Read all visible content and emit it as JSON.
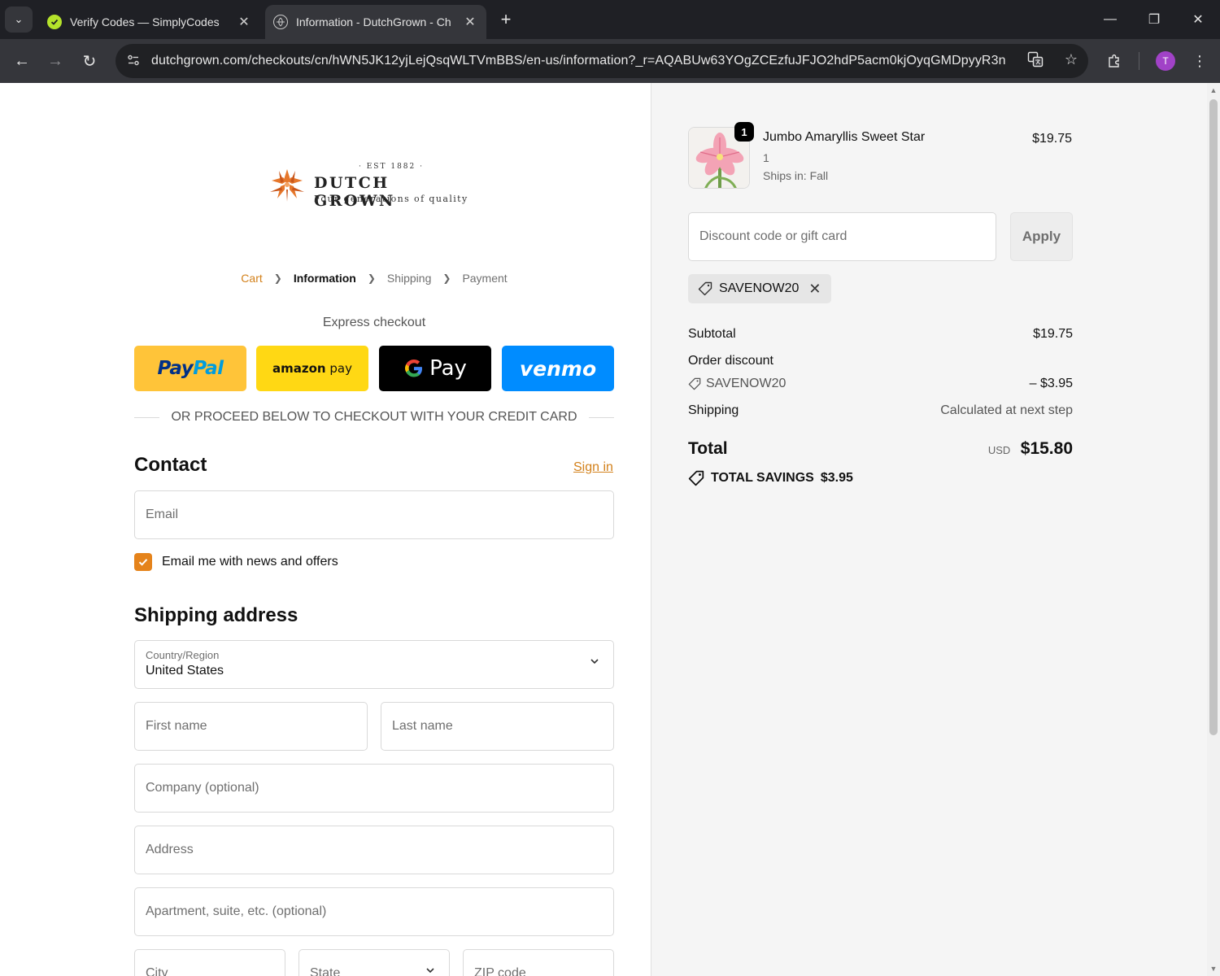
{
  "browser": {
    "tabs": [
      {
        "title": "Verify Codes — SimplyCodes",
        "active": false
      },
      {
        "title": "Information - DutchGrown - Ch",
        "active": true
      }
    ],
    "url": "dutchgrown.com/checkouts/cn/hWN5JK12yjLejQsqWLTVmBBS/en-us/information?_r=AQABUw63YOgZCEzfuJFJO2hdP5acm0kjOyqGMDpyyR3n",
    "profile_initial": "T",
    "accent_colors": {
      "profile": "#a142c7",
      "simplycodes": "#b5e32b"
    }
  },
  "store": {
    "logo_est": "· EST 1882 ·",
    "logo_name": "DUTCH GROWN",
    "logo_tagline": "Four generations of quality",
    "accent_color": "#d3811b"
  },
  "breadcrumb": {
    "items": [
      {
        "label": "Cart",
        "state": "link"
      },
      {
        "label": "Information",
        "state": "current"
      },
      {
        "label": "Shipping",
        "state": "upcoming"
      },
      {
        "label": "Payment",
        "state": "upcoming"
      }
    ]
  },
  "express": {
    "label": "Express checkout",
    "buttons": [
      {
        "name": "PayPal",
        "color": "#ffc439"
      },
      {
        "name": "amazon pay",
        "color": "#ffd814"
      },
      {
        "name": "G Pay",
        "color": "#000000"
      },
      {
        "name": "venmo",
        "color": "#008cff"
      }
    ],
    "divider_text": "OR PROCEED BELOW TO CHECKOUT WITH YOUR CREDIT CARD"
  },
  "contact": {
    "heading": "Contact",
    "sign_in": "Sign in",
    "email_placeholder": "Email",
    "newsletter_label": "Email me with news and offers",
    "newsletter_checked": true
  },
  "shipping": {
    "heading": "Shipping address",
    "country_label": "Country/Region",
    "country_value": "United States",
    "first_name_placeholder": "First name",
    "last_name_placeholder": "Last name",
    "company_placeholder": "Company (optional)",
    "address_placeholder": "Address",
    "apartment_placeholder": "Apartment, suite, etc. (optional)",
    "city_placeholder": "City",
    "state_placeholder": "State",
    "zip_placeholder": "ZIP code"
  },
  "summary": {
    "item": {
      "name": "Jumbo Amaryllis Sweet Star",
      "quantity": "1",
      "ships": "Ships in: Fall",
      "price": "$19.75",
      "badge": "1"
    },
    "discount_placeholder": "Discount code or gift card",
    "apply_label": "Apply",
    "applied_code": "SAVENOW20",
    "subtotal_label": "Subtotal",
    "subtotal_value": "$19.75",
    "order_discount_label": "Order discount",
    "order_discount_code": "SAVENOW20",
    "order_discount_value": "– $3.95",
    "shipping_label": "Shipping",
    "shipping_value": "Calculated at next step",
    "total_label": "Total",
    "total_currency": "USD",
    "total_value": "$15.80",
    "savings_label": "TOTAL SAVINGS",
    "savings_value": "$3.95"
  }
}
